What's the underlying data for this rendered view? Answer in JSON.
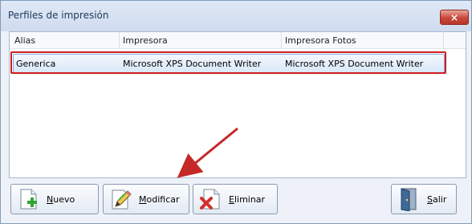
{
  "window": {
    "title": "Perfiles de impresión",
    "close_glyph": "×"
  },
  "list": {
    "columns": [
      "Alias",
      "Impresora",
      "Impresora Fotos"
    ],
    "rows": [
      {
        "alias": "Generica",
        "impresora": "Microsoft XPS Document Writer",
        "impresora_fotos": "Microsoft XPS Document Writer"
      }
    ]
  },
  "buttons": {
    "nuevo": {
      "mnemonic": "N",
      "rest": "uevo",
      "icon": "new-document-plus-icon"
    },
    "modificar": {
      "mnemonic": "M",
      "rest": "odificar",
      "icon": "edit-pencil-icon"
    },
    "eliminar": {
      "mnemonic": "E",
      "rest": "liminar",
      "icon": "delete-document-icon"
    },
    "salir": {
      "mnemonic": "S",
      "rest": "alir",
      "icon": "exit-door-icon"
    }
  },
  "colors": {
    "highlight": "#cc1f1f",
    "arrow": "#c62828"
  }
}
